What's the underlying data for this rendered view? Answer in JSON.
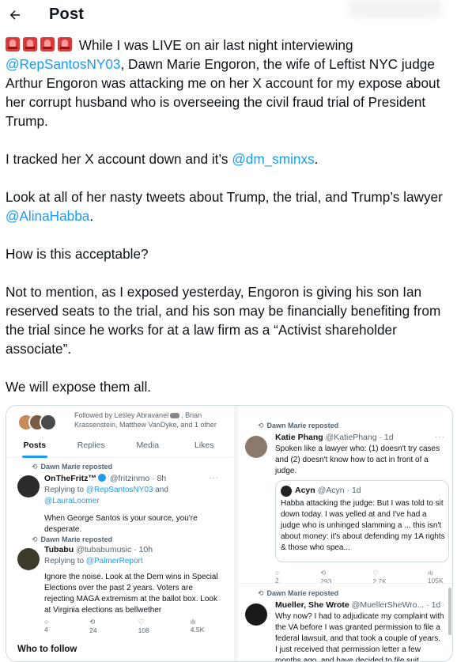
{
  "header": {
    "title": "Post"
  },
  "post": {
    "line1_text": "While I was LIVE on air last night interviewing",
    "mention_santos": "@RepSantosNY03",
    "para1_rest": ", Dawn Marie Engoron, the wife of Leftist NYC judge Arthur Engoron was attacking me on her X account for my expose about her corrupt husband who is overseeing the civil fraud trial of President Trump.",
    "para2_text": "I tracked her X account down and it’s ",
    "mention_dm": "@dm_sminxs",
    "para2_end": ".",
    "para3_text": "Look at all of her nasty tweets about Trump, the trial, and Trump’s lawyer ",
    "mention_habba": "@AlinaHabba",
    "para3_end": ".",
    "para4": "How is this acceptable?",
    "para5": "Not to mention, as I exposed yesterday, Engoron is giving his son Ian reserved seats to the trial, and his son may be financially benefiting from the trial since he works for at a law firm as a “Activist shareholder associate”.",
    "para6": "We will expose them all."
  },
  "media": {
    "left": {
      "followed_by": "Followed by Lesley Abravanel",
      "followed_by_rest": ", Brian Krassenstein, Matthew VanDyke, and 1 other",
      "tabs": [
        "Posts",
        "Replies",
        "Media",
        "Likes"
      ],
      "reposted_label": "Dawn Marie reposted",
      "tweet1": {
        "name": "OnTheFritz™",
        "handle": "@fritzinmo · 8h",
        "replying_to": "Replying to",
        "reply_mention1": "@RepSantosNY03",
        "reply_and": "and",
        "reply_mention2": "@LauraLoomer",
        "text": "When George Santos is your source, you're desperate."
      },
      "tweet2": {
        "name": "Tubabu",
        "handle": "@tubabumusic · 10h",
        "replying_to": "Replying to",
        "reply_mention": "@PalmerReport",
        "text": "Ignore the noise. Look at the Dem wins in Special Elections over the past 2 years. Voters are rejecting MAGA extremism at the ballot box. Look at Virginia elections as bellwether",
        "replies": "4",
        "reposts": "24",
        "likes": "108",
        "views": "4.5K"
      },
      "who_to_follow": "Who to follow"
    },
    "right": {
      "reposted_label": "Dawn Marie reposted",
      "tweet1": {
        "name": "Katie Phang",
        "handle": "@KatiePhang · 1d",
        "text": "Spoken like a lawyer who: (1) doesn't try cases and (2) doesn't know how to act in front of a judge."
      },
      "quote": {
        "name": "Acyn",
        "handle": "@Acyn · 1d",
        "text": "Habba attacking the judge: But I was told to sit down today. I was yelled at and I've had a judge who is unhinged slamming a ... this isn't about money: it's about defending my 1A rights & those who spea..."
      },
      "tweet1_actions": {
        "replies": "2",
        "reposts": "293",
        "likes": "2.7K",
        "views": "105K"
      },
      "reposted_label2": "Dawn Marie reposted",
      "tweet2": {
        "name": "Mueller, She Wrote",
        "handle": "@MuellerSheWro... · 1d",
        "text": "Why now? I had to adjudicate my complaint with the VA before I was granted permission to file a federal lawsuit, and that took a couple of years. I just received that permission letter a few months ago, and have decided to file suit..."
      }
    }
  },
  "colors": {
    "accent": "#1d9bf0",
    "text": "#0f1419",
    "secondary": "#536471",
    "border": "#cfd9de"
  },
  "icons": [
    "back-arrow-icon",
    "siren-icon",
    "repost-icon",
    "reply-icon",
    "like-icon",
    "views-icon",
    "share-icon",
    "more-icon",
    "verified-icon"
  ]
}
